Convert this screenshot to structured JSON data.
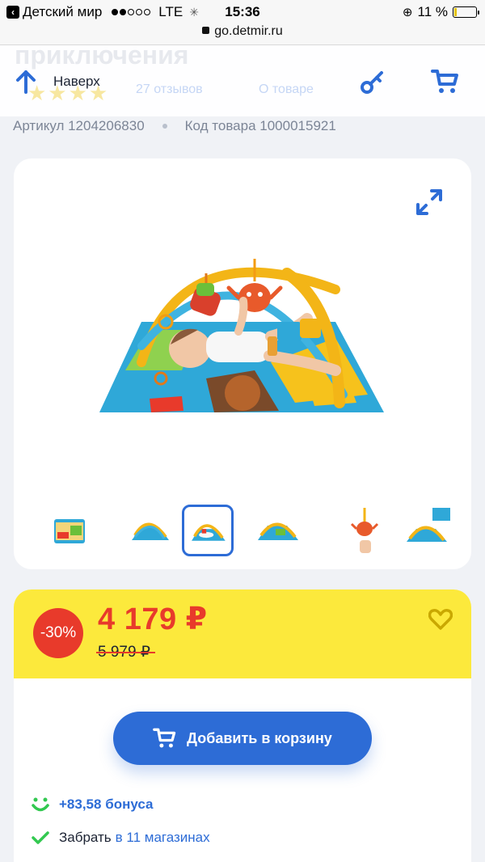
{
  "status_bar": {
    "back_app": "Детский мир",
    "carrier": "LTE",
    "time": "15:36",
    "battery": "11 %"
  },
  "browser": {
    "url": "go.detmir.ru"
  },
  "header": {
    "ghost_title": "приключения",
    "reviews_count": "27 отзывов",
    "about_tab": "О товаре",
    "up_label": "Наверх"
  },
  "product": {
    "article": "Артикул 1204206830",
    "code": "Код товара 1000015921"
  },
  "gallery": {
    "active_index": 2,
    "thumb_count": 6
  },
  "price": {
    "discount": "-30%",
    "current": "4 179 ₽",
    "old": "5 979 ₽"
  },
  "actions": {
    "add_to_cart": "Добавить в корзину",
    "bonus": "+83,58 бонуса",
    "pickup_prefix": "Забрать",
    "pickup_link": "в 11 магазинах"
  },
  "colors": {
    "accent": "#2d6cd6",
    "sale": "#e83a2b",
    "price_bg": "#fce93c",
    "bonus": "#32c850"
  }
}
